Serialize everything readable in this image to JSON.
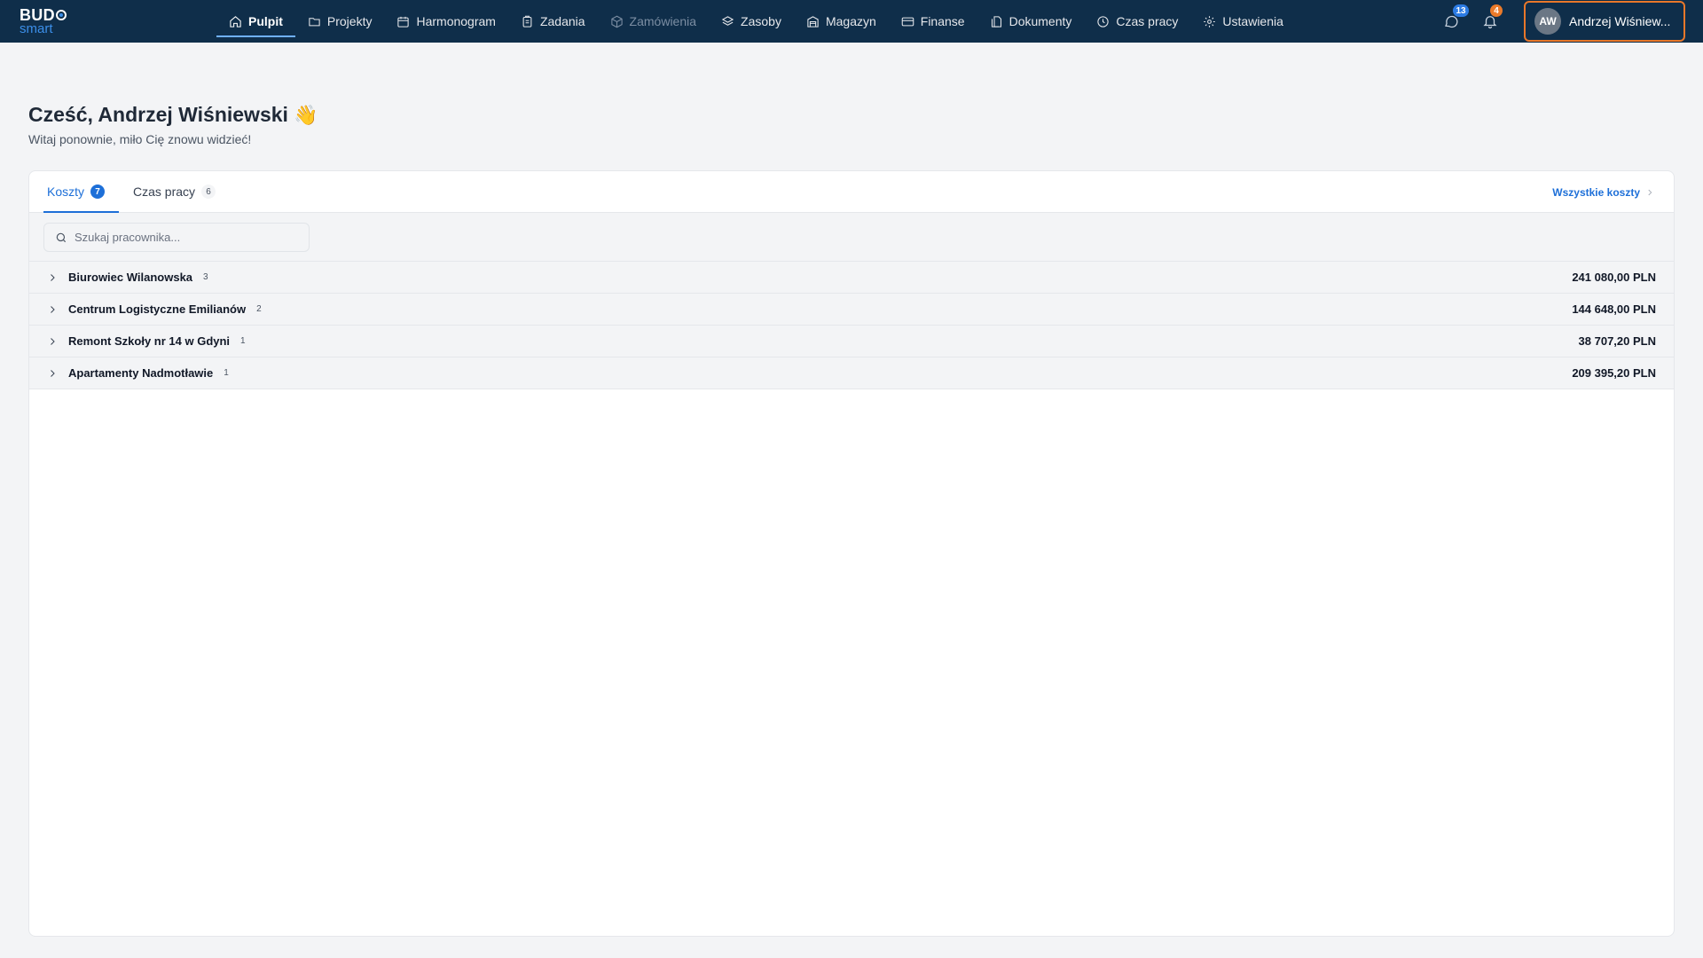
{
  "logo": {
    "top": "BUD",
    "bottom": "smart"
  },
  "nav": [
    {
      "label": "Pulpit",
      "icon": "home-icon",
      "state": "active"
    },
    {
      "label": "Projekty",
      "icon": "folder-icon",
      "state": "normal"
    },
    {
      "label": "Harmonogram",
      "icon": "calendar-icon",
      "state": "normal"
    },
    {
      "label": "Zadania",
      "icon": "clipboard-icon",
      "state": "normal"
    },
    {
      "label": "Zamówienia",
      "icon": "package-icon",
      "state": "disabled"
    },
    {
      "label": "Zasoby",
      "icon": "layers-icon",
      "state": "normal"
    },
    {
      "label": "Magazyn",
      "icon": "warehouse-icon",
      "state": "normal"
    },
    {
      "label": "Finanse",
      "icon": "credit-card-icon",
      "state": "normal"
    },
    {
      "label": "Dokumenty",
      "icon": "documents-icon",
      "state": "normal"
    },
    {
      "label": "Czas pracy",
      "icon": "clock-icon",
      "state": "normal"
    },
    {
      "label": "Ustawienia",
      "icon": "gear-icon",
      "state": "normal"
    }
  ],
  "header_right": {
    "messages_badge": "13",
    "notifications_badge": "4",
    "user": {
      "initials": "AW",
      "name": "Andrzej Wiśniew..."
    }
  },
  "greeting": {
    "title": "Cześć, Andrzej Wiśniewski",
    "emoji": "👋",
    "subtitle": "Witaj ponownie, miło Cię znowu widzieć!"
  },
  "card": {
    "tabs": [
      {
        "label": "Koszty",
        "count": "7",
        "active": true
      },
      {
        "label": "Czas pracy",
        "count": "6",
        "active": false
      }
    ],
    "all_link": "Wszystkie koszty",
    "search": {
      "placeholder": "Szukaj pracownika..."
    },
    "groups": [
      {
        "name": "Biurowiec Wilanowska",
        "count": "3",
        "amount": "241 080,00 PLN"
      },
      {
        "name": "Centrum Logistyczne Emilianów",
        "count": "2",
        "amount": "144 648,00 PLN"
      },
      {
        "name": "Remont Szkoły nr 14 w Gdyni",
        "count": "1",
        "amount": "38 707,20 PLN"
      },
      {
        "name": "Apartamenty Nadmotławie",
        "count": "1",
        "amount": "209 395,20 PLN"
      }
    ]
  },
  "colors": {
    "topbar": "#0f2e4a",
    "accent": "#1d6fd8",
    "user_chip_border": "#e8772a"
  }
}
